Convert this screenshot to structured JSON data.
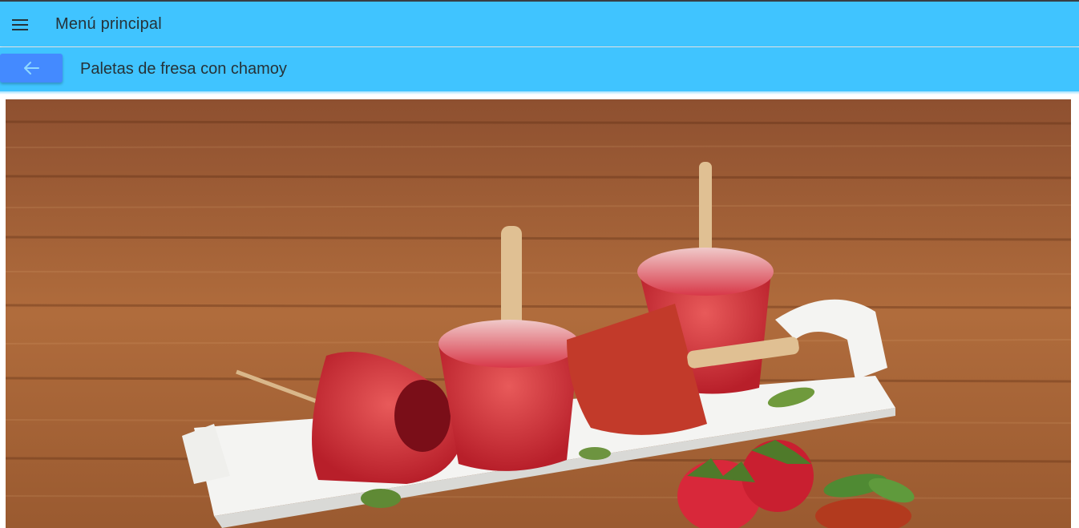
{
  "app_bar": {
    "menu_icon": "hamburger-menu-icon",
    "title": "Menú principal",
    "background": "#40c4ff"
  },
  "recipe_bar": {
    "back_icon": "arrow-left-icon",
    "back_button_color": "#448aff",
    "title": "Paletas de fresa con chamoy"
  },
  "hero_image": {
    "subject": "strawberry-chamoy-popsicles-photo"
  }
}
